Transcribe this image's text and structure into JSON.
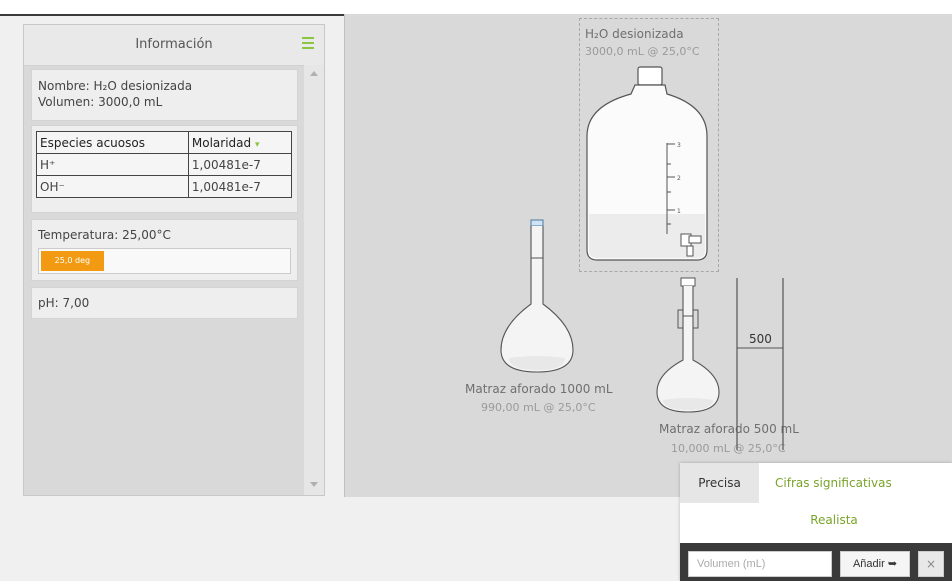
{
  "info_panel": {
    "title": "Información",
    "name_label": "Nombre: H₂O desionizada",
    "volume_label": "Volumen: 3000,0 mL",
    "table": {
      "headers": [
        "Especies acuosos",
        "Molaridad"
      ],
      "rows": [
        {
          "species": "H⁺",
          "value": "1,00481e-7"
        },
        {
          "species": "OH⁻",
          "value": "1,00481e-7"
        }
      ]
    },
    "temperature_label": "Temperatura: 25,00°C",
    "temperature_bar_text": "25,0 deg",
    "temperature_fraction": 0.25,
    "ph_label": "pH: 7,00"
  },
  "workspace": {
    "bottle": {
      "title": "H₂O desionizada",
      "subtitle": "3000,0 mL @ 25,0°C",
      "ticks": [
        "3",
        "2",
        "1"
      ]
    },
    "flask_1000": {
      "title": "Matraz aforado 1000 mL",
      "subtitle": "990,00 mL @ 25,0°C"
    },
    "flask_500": {
      "title": "Matraz aforado 500 mL",
      "subtitle": "10,000 mL @ 25,0°C"
    },
    "cylinder_label": "500"
  },
  "popup": {
    "tab_precise": "Precisa",
    "tab_sigfig": "Cifras significativas",
    "tab_realistic": "Realista",
    "volume_placeholder": "Volumen (mL)",
    "add_button": "Añadir",
    "close_symbol": "×"
  },
  "colors": {
    "accent": "#8cc63f",
    "temperature": "#f29b12"
  }
}
